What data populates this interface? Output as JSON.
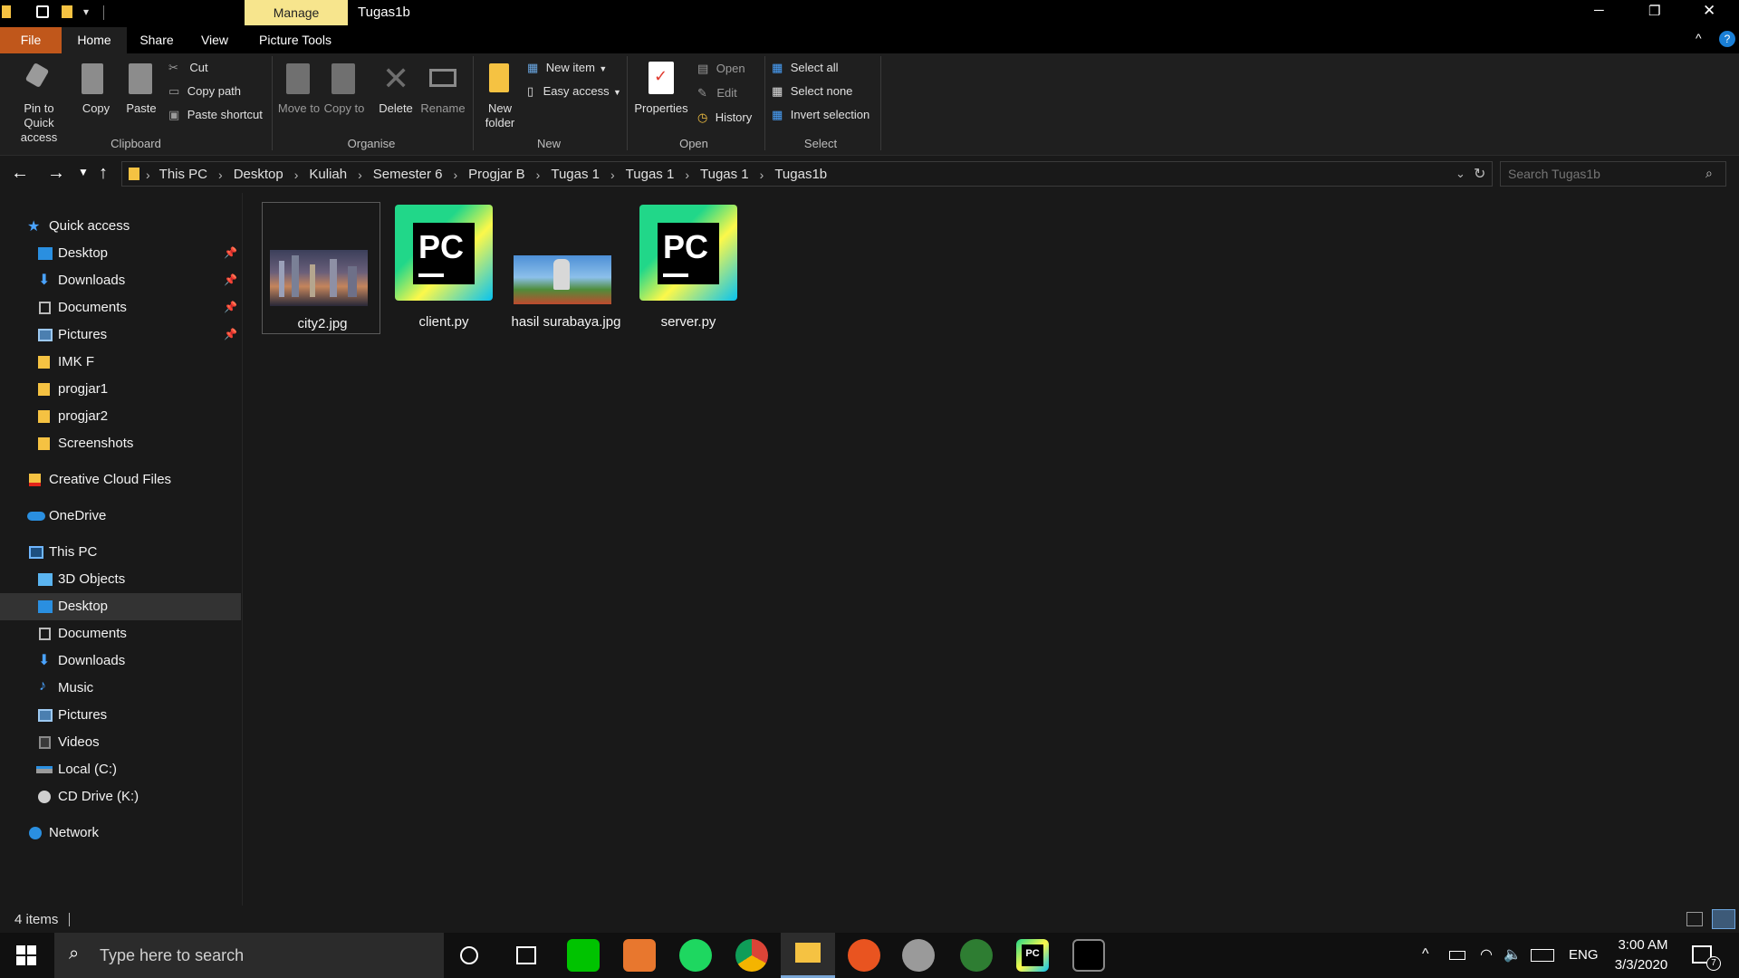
{
  "window": {
    "title": "Tugas1b",
    "manage_tab": "Manage",
    "controls": {
      "minimize": "─",
      "restore": "❐",
      "close": "✕"
    }
  },
  "ribbon_tabs": [
    "File",
    "Home",
    "Share",
    "View",
    "Picture Tools"
  ],
  "clipboard": {
    "pin_label": "Pin to Quick access",
    "copy_label": "Copy",
    "paste_label": "Paste",
    "cut_label": "Cut",
    "copy_path_label": "Copy path",
    "paste_shortcut_label": "Paste shortcut",
    "group_label": "Clipboard"
  },
  "organise": {
    "move_to_label": "Move to",
    "copy_to_label": "Copy to",
    "delete_label": "Delete",
    "rename_label": "Rename",
    "group_label": "Organise"
  },
  "new_group": {
    "new_folder_label": "New folder",
    "new_item_label": "New item",
    "easy_access_label": "Easy access",
    "group_label": "New"
  },
  "open_group": {
    "properties_label": "Properties",
    "open_label": "Open",
    "edit_label": "Edit",
    "history_label": "History",
    "group_label": "Open"
  },
  "select_group": {
    "select_all_label": "Select all",
    "select_none_label": "Select none",
    "invert_label": "Invert selection",
    "group_label": "Select"
  },
  "breadcrumb": [
    "This PC",
    "Desktop",
    "Kuliah",
    "Semester 6",
    "Progjar B",
    "Tugas 1",
    "Tugas 1",
    "Tugas 1",
    "Tugas1b"
  ],
  "search": {
    "placeholder": "Search Tugas1b"
  },
  "nav": {
    "quick_access": "Quick access",
    "quick_items": [
      "Desktop",
      "Downloads",
      "Documents",
      "Pictures",
      "IMK F",
      "progjar1",
      "progjar2",
      "Screenshots"
    ],
    "creative_cloud": "Creative Cloud Files",
    "onedrive": "OneDrive",
    "this_pc": "This PC",
    "pc_items": [
      "3D Objects",
      "Desktop",
      "Documents",
      "Downloads",
      "Music",
      "Pictures",
      "Videos",
      "Local (C:)",
      "CD Drive (K:)"
    ],
    "network": "Network"
  },
  "files": [
    {
      "name": "city2.jpg",
      "type": "image"
    },
    {
      "name": "client.py",
      "type": "pycharm"
    },
    {
      "name": "hasil surabaya.jpg",
      "type": "image"
    },
    {
      "name": "server.py",
      "type": "pycharm"
    }
  ],
  "status": {
    "item_count": "4 items"
  },
  "taskbar": {
    "search_placeholder": "Type here to search",
    "language": "ENG",
    "time": "3:00 AM",
    "date": "3/3/2020",
    "notification_count": "7"
  },
  "colors": {
    "file_tab": "#c0571b",
    "manage_tab": "#f7e58d",
    "folder": "#f5c242",
    "accent_blue": "#0078d7"
  }
}
